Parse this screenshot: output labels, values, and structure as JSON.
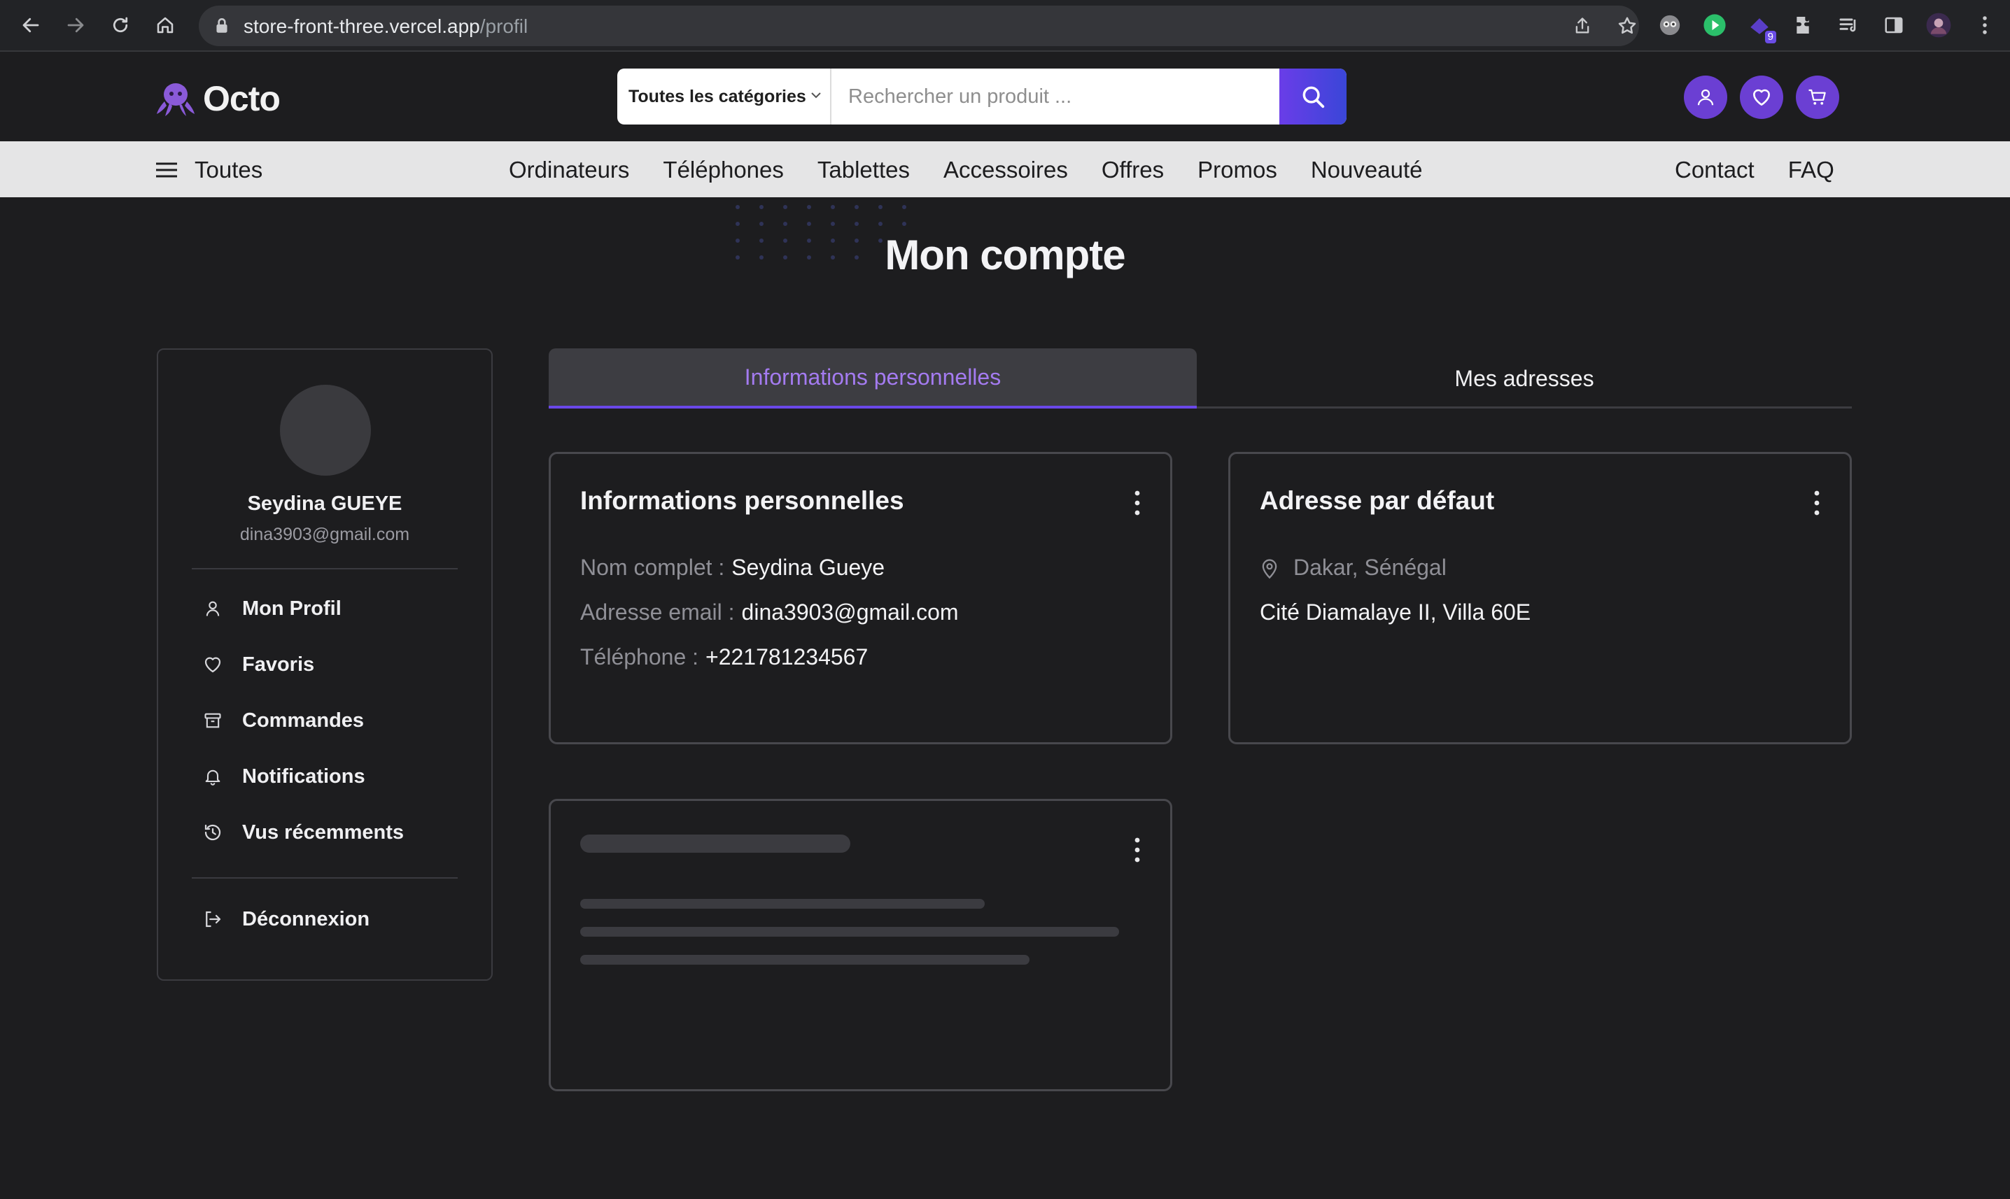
{
  "browser": {
    "url_host": "store-front-three.vercel.app",
    "url_path": "/profil",
    "extension_badge": "9"
  },
  "header": {
    "logo_text": "Octo",
    "category_select": "Toutes les catégories",
    "search_placeholder": "Rechercher un produit ..."
  },
  "catbar": {
    "all_label": "Toutes",
    "links": [
      "Ordinateurs",
      "Téléphones",
      "Tablettes",
      "Accessoires",
      "Offres",
      "Promos",
      "Nouveauté"
    ],
    "right_links": [
      "Contact",
      "FAQ"
    ]
  },
  "page": {
    "title": "Mon compte"
  },
  "profile": {
    "name": "Seydina GUEYE",
    "email": "dina3903@gmail.com"
  },
  "sidebar": {
    "items": [
      {
        "label": "Mon Profil",
        "icon": "user-icon"
      },
      {
        "label": "Favoris",
        "icon": "heart-icon"
      },
      {
        "label": "Commandes",
        "icon": "archive-icon"
      },
      {
        "label": "Notifications",
        "icon": "bell-icon"
      },
      {
        "label": "Vus récemments",
        "icon": "history-icon"
      }
    ],
    "logout": {
      "label": "Déconnexion",
      "icon": "logout-icon"
    }
  },
  "tabs": {
    "active": "Informations personnelles",
    "inactive": "Mes adresses"
  },
  "personal_card": {
    "title": "Informations personnelles",
    "rows": [
      {
        "label": "Nom complet :",
        "value": "Seydina Gueye"
      },
      {
        "label": "Adresse email :",
        "value": "dina3903@gmail.com"
      },
      {
        "label": "Téléphone :",
        "value": "+221781234567"
      }
    ]
  },
  "address_card": {
    "title": "Adresse par défaut",
    "city": "Dakar, Sénégal",
    "street": "Cité Diamalaye II, Villa 60E"
  },
  "colors": {
    "accent": "#6b3fd3",
    "tab_active_text": "#a47bf0",
    "background": "#1d1d1f"
  }
}
